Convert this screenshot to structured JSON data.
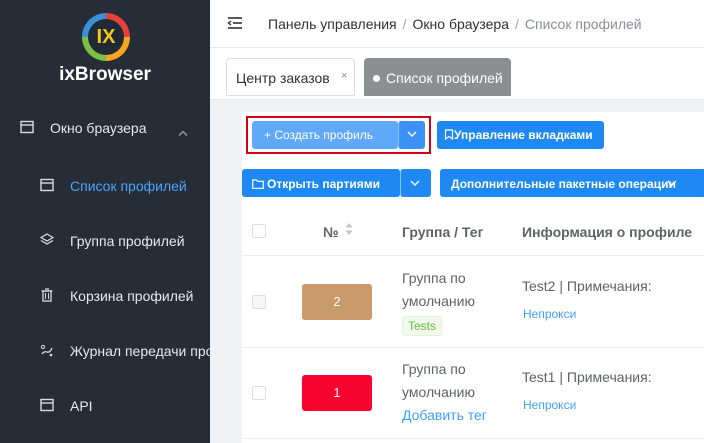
{
  "app": {
    "logo_text": "IX",
    "name": "ixBrowser"
  },
  "sidebar": {
    "group": {
      "label": "Окно браузера",
      "icon": "browser-window-icon",
      "expanded": true
    },
    "items": [
      {
        "label": "Список профилей",
        "icon": "profile-list-icon",
        "active": true
      },
      {
        "label": "Группа профилей",
        "icon": "layers-icon",
        "active": false
      },
      {
        "label": "Корзина профилей",
        "icon": "trash-icon",
        "active": false
      },
      {
        "label": "Журнал передачи про",
        "icon": "transfer-log-icon",
        "active": false
      },
      {
        "label": "API",
        "icon": "api-icon",
        "active": false
      }
    ]
  },
  "header": {
    "breadcrumb": [
      "Панель управления",
      "Окно браузера",
      "Список профилей"
    ],
    "separator": "/"
  },
  "tabs": [
    {
      "label": "Центр заказов",
      "close": "×",
      "active": false
    },
    {
      "label": "Список профилей",
      "active": true
    }
  ],
  "toolbar": {
    "create_label": "+ Создать профиль",
    "tabs_label": "Управление вкладками",
    "open_label": "Открыть партиями",
    "batch_label": "Дополнительные пакетные операции"
  },
  "table": {
    "columns": [
      "№",
      "Группа / Тег",
      "Информация о профиле"
    ],
    "rows": [
      {
        "num": "2",
        "color": "#c99a6a",
        "group_line1": "Группа по",
        "group_line2": "умолчанию",
        "tag": "Tests",
        "info": "Test2 | Примечания:",
        "proxy": "Непрокси"
      },
      {
        "num": "1",
        "color": "#f5052f",
        "group_line1": "Группа по",
        "group_line2": "умолчанию",
        "add_tag": "Добавить тег",
        "info": "Test1 | Примечания:",
        "proxy": "Непрокси"
      }
    ]
  },
  "colors": {
    "sidebar_bg": "#262d36",
    "primary": "#1e88f3",
    "highlight_box": "#d0021b",
    "active_nav": "#4aa3ff"
  }
}
